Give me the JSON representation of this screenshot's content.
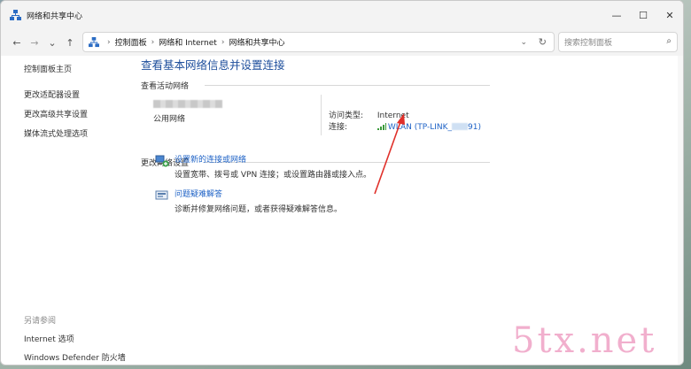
{
  "window": {
    "title": "网络和共享中心"
  },
  "controls": {
    "minimize": "—",
    "maximize": "☐",
    "close": "✕"
  },
  "nav": {
    "back": "←",
    "forward": "→",
    "recent": "⌄",
    "up": "↑",
    "breadcrumbs": [
      "控制面板",
      "网络和 Internet",
      "网络和共享中心"
    ],
    "chevron": "⌄",
    "refresh": "↻"
  },
  "search": {
    "placeholder": "搜索控制面板",
    "icon": "⌕"
  },
  "sidebar": {
    "home": "控制面板主页",
    "items": [
      "更改适配器设置",
      "更改高级共享设置",
      "媒体流式处理选项"
    ]
  },
  "see_also": {
    "header": "另请参阅",
    "items": [
      "Internet 选项",
      "Windows Defender 防火墙"
    ]
  },
  "main": {
    "title": "查看基本网络信息并设置连接",
    "active_networks_header": "查看活动网络",
    "network_type": "公用网络",
    "access_type_label": "访问类型:",
    "access_type_value": "Internet",
    "connections_label": "连接:",
    "connection_link_prefix": "WLAN (TP-LINK_",
    "connection_link_suffix": "91)",
    "change_settings_header": "更改网络设置",
    "tasks": [
      {
        "link": "设置新的连接或网络",
        "desc": "设置宽带、拨号或 VPN 连接；或设置路由器或接入点。"
      },
      {
        "link": "问题疑难解答",
        "desc": "诊断并修复网络问题，或者获得疑难解答信息。"
      }
    ]
  },
  "watermark": "5tx.net",
  "colors": {
    "accent_link": "#1e62c6",
    "title_blue": "#1e4f9c",
    "arrow_red": "#e0302a",
    "watermark_pink": "#f0a7c8"
  }
}
